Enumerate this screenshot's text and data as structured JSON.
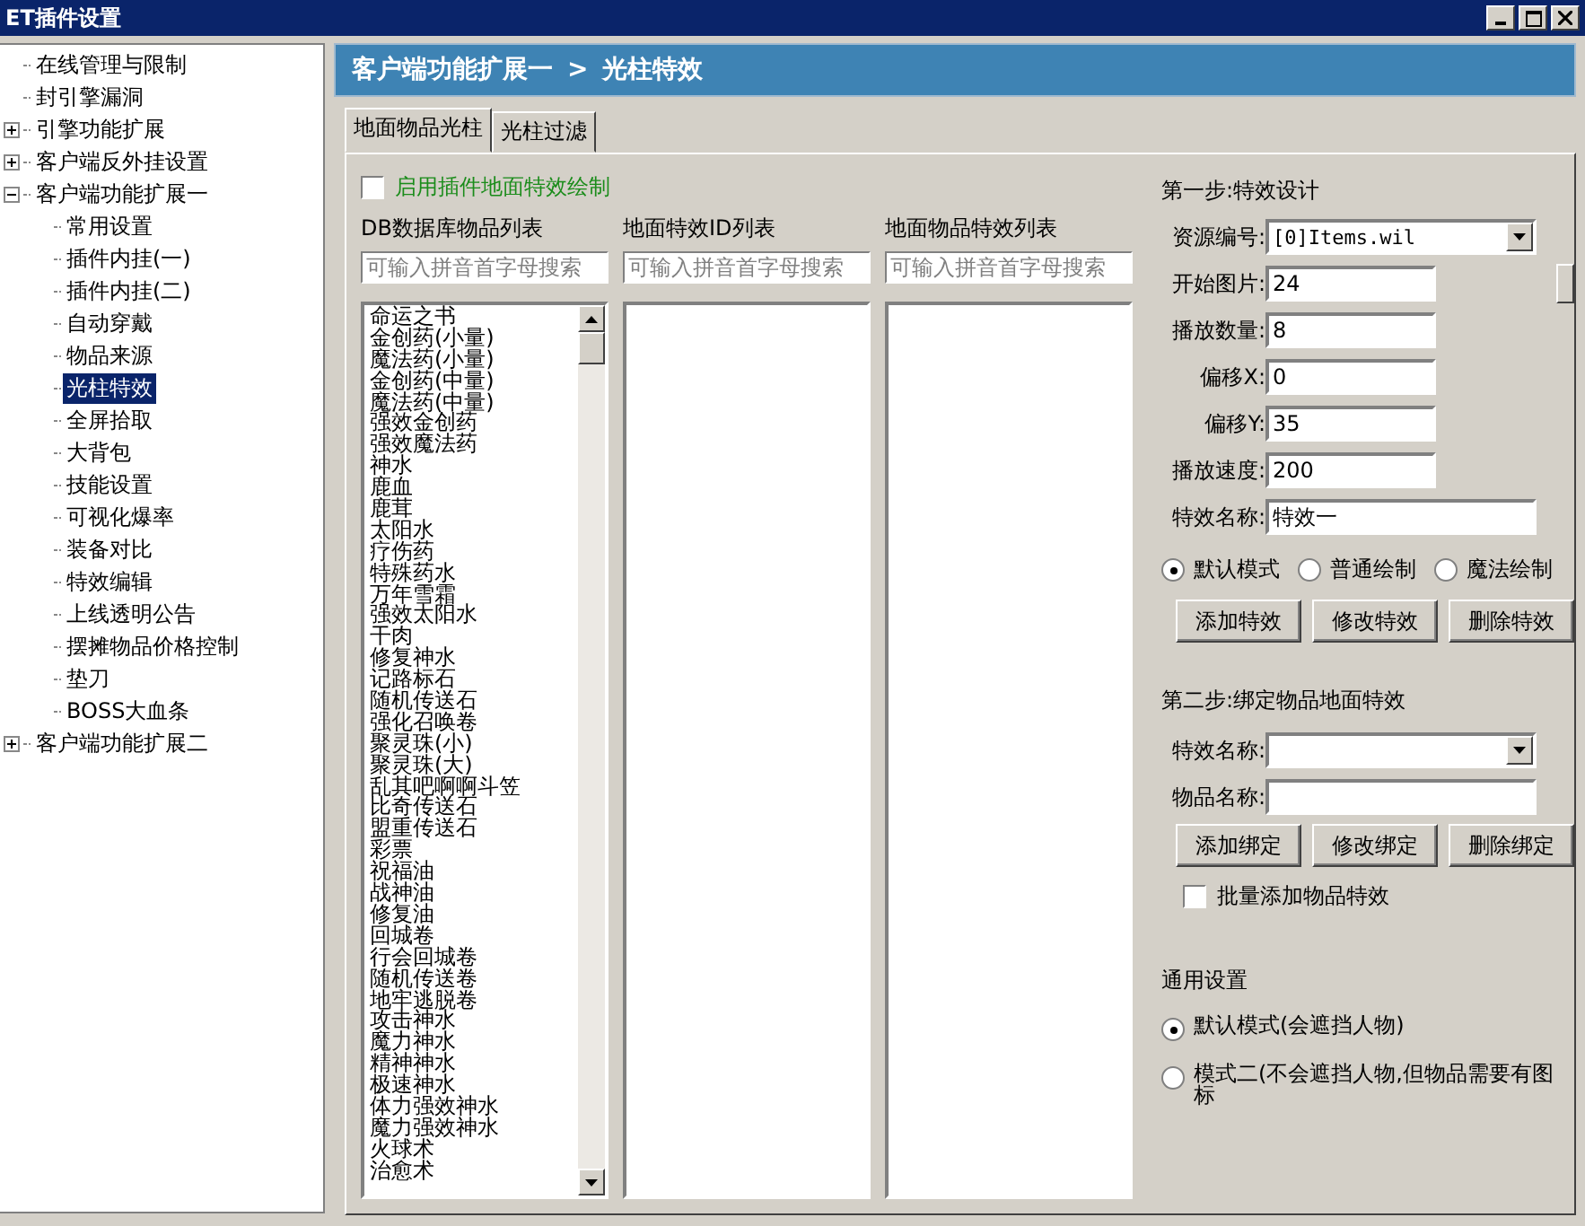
{
  "window": {
    "title": "ET插件设置"
  },
  "tree": [
    {
      "label": "在线管理与限制",
      "selected": false
    },
    {
      "label": "封引擎漏洞",
      "selected": false
    },
    {
      "label": "引擎功能扩展",
      "selected": false,
      "expanded": false
    },
    {
      "label": "客户端反外挂设置",
      "selected": false,
      "expanded": false
    },
    {
      "label": "客户端功能扩展一",
      "selected": false,
      "expanded": true,
      "children": [
        {
          "label": "常用设置",
          "selected": false
        },
        {
          "label": "插件内挂(一)",
          "selected": false
        },
        {
          "label": "插件内挂(二)",
          "selected": false
        },
        {
          "label": "自动穿戴",
          "selected": false
        },
        {
          "label": "物品来源",
          "selected": false
        },
        {
          "label": "光柱特效",
          "selected": true
        },
        {
          "label": "全屏拾取",
          "selected": false
        },
        {
          "label": "大背包",
          "selected": false
        },
        {
          "label": "技能设置",
          "selected": false
        },
        {
          "label": "可视化爆率",
          "selected": false
        },
        {
          "label": "装备对比",
          "selected": false
        },
        {
          "label": "特效编辑",
          "selected": false
        },
        {
          "label": "上线透明公告",
          "selected": false
        },
        {
          "label": "摆摊物品价格控制",
          "selected": false
        },
        {
          "label": "垫刀",
          "selected": false
        },
        {
          "label": "BOSS大血条",
          "selected": false
        }
      ]
    },
    {
      "label": "客户端功能扩展二",
      "selected": false,
      "expanded": false
    }
  ],
  "header": {
    "section": "客户端功能扩展一",
    "separator": ">",
    "page": "光柱特效"
  },
  "tabs": [
    {
      "label": "地面物品光柱",
      "selected": true
    },
    {
      "label": "光柱过滤",
      "selected": false
    }
  ],
  "enable": {
    "label": "启用插件地面特效绘制",
    "checked": false
  },
  "lists": [
    {
      "title": "DB数据库物品列表",
      "placeholder": "可输入拼音首字母搜索",
      "items": [
        "命运之书",
        "金创药(小量)",
        "魔法药(小量)",
        "金创药(中量)",
        "魔法药(中量)",
        "强效金创药",
        "强效魔法药",
        "神水",
        "鹿血",
        "鹿茸",
        "太阳水",
        "疗伤药",
        "特殊药水",
        "万年雪霜",
        "强效太阳水",
        "干肉",
        "修复神水",
        "记路标石",
        "随机传送石",
        "强化召唤卷",
        "聚灵珠(小)",
        "聚灵珠(大)",
        "乱其吧啊啊斗笠",
        "比奇传送石",
        "盟重传送石",
        "彩票",
        "祝福油",
        "战神油",
        "修复油",
        "回城卷",
        "行会回城卷",
        "随机传送卷",
        "地牢逃脱卷",
        "攻击神水",
        "魔力神水",
        "精神神水",
        "极速神水",
        "体力强效神水",
        "魔力强效神水",
        "火球术",
        "治愈术"
      ]
    },
    {
      "title": "地面特效ID列表",
      "placeholder": "可输入拼音首字母搜索"
    },
    {
      "title": "地面物品特效列表",
      "placeholder": "可输入拼音首字母搜索"
    }
  ],
  "step1": {
    "title": "第一步:特效设计",
    "fields": [
      {
        "label": "资源编号:",
        "value": "[0]Items.wil",
        "kind": "select"
      },
      {
        "label": "开始图片:",
        "value": "24",
        "kind": "short"
      },
      {
        "label": "播放数量:",
        "value": "8",
        "kind": "short"
      },
      {
        "label": "偏移X:",
        "value": "0",
        "kind": "short"
      },
      {
        "label": "偏移Y:",
        "value": "35",
        "kind": "short"
      },
      {
        "label": "播放速度:",
        "value": "200",
        "kind": "short"
      },
      {
        "label": "特效名称:",
        "value": "特效一",
        "kind": "long"
      }
    ],
    "modes": [
      {
        "label": "默认模式",
        "selected": true
      },
      {
        "label": "普通绘制",
        "selected": false
      },
      {
        "label": "魔法绘制",
        "selected": false
      }
    ],
    "buttons": [
      "添加特效",
      "修改特效",
      "删除特效"
    ]
  },
  "step2": {
    "title": "第二步:绑定物品地面特效",
    "fields": [
      {
        "label": "特效名称:",
        "kind": "select"
      },
      {
        "label": "物品名称:",
        "kind": "long"
      }
    ],
    "buttons": [
      "添加绑定",
      "修改绑定",
      "删除绑定"
    ],
    "batch": {
      "label": "批量添加物品特效",
      "checked": false
    }
  },
  "general": {
    "title": "通用设置",
    "modes": [
      {
        "label": "默认模式(会遮挡人物)",
        "selected": true
      },
      {
        "label": "模式二(不会遮挡人物,但物品需要有图标",
        "selected": false
      }
    ]
  }
}
